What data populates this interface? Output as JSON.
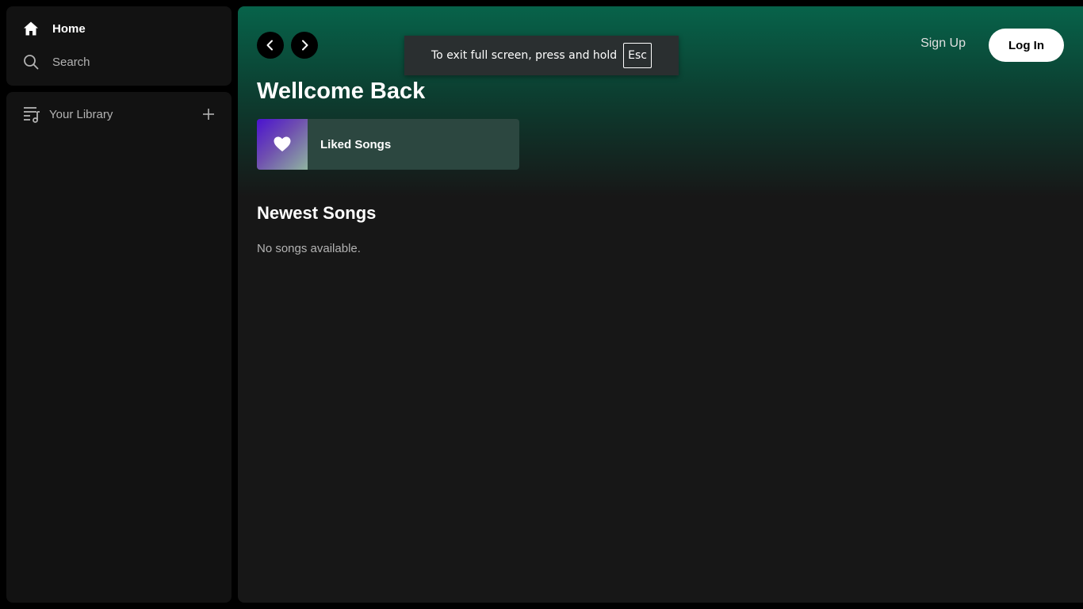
{
  "sidebar": {
    "nav": {
      "home": {
        "label": "Home",
        "icon": "home-icon"
      },
      "search": {
        "label": "Search",
        "icon": "search-icon"
      }
    },
    "library": {
      "label": "Your Library",
      "icon": "library-icon",
      "add_icon": "plus-icon"
    }
  },
  "header": {
    "back_icon": "chevron-left-icon",
    "forward_icon": "chevron-right-icon",
    "signup_label": "Sign Up",
    "login_label": "Log In"
  },
  "main": {
    "title": "Wellcome Back",
    "liked_songs": {
      "label": "Liked Songs",
      "icon": "heart-icon"
    },
    "newest": {
      "title": "Newest Songs",
      "empty_text": "No songs available."
    }
  },
  "fullscreen_toast": {
    "message": "To exit full screen, press and hold",
    "key": "Esc"
  },
  "colors": {
    "accent_gradient_top": "#07634a",
    "background": "#171717",
    "sidebar": "#121212",
    "liked_card": "#2c4740"
  }
}
